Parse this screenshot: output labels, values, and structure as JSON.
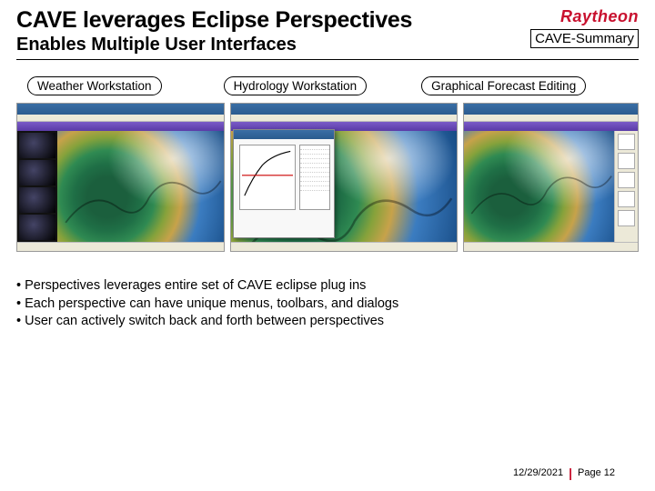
{
  "header": {
    "title": "CAVE leverages Eclipse Perspectives",
    "subtitle": "Enables Multiple User Interfaces",
    "brand": "Raytheon",
    "badge": "CAVE-Summary"
  },
  "labels": {
    "a": "Weather Workstation",
    "b": "Hydrology Workstation",
    "c": "Graphical Forecast Editing"
  },
  "bullets": {
    "b1": "• Perspectives leverages entire set of CAVE eclipse plug ins",
    "b2": "• Each perspective can have unique menus, toolbars, and dialogs",
    "b3": "• User can actively switch back and forth between perspectives"
  },
  "footer": {
    "date": "12/29/2021",
    "page": "Page 12"
  }
}
